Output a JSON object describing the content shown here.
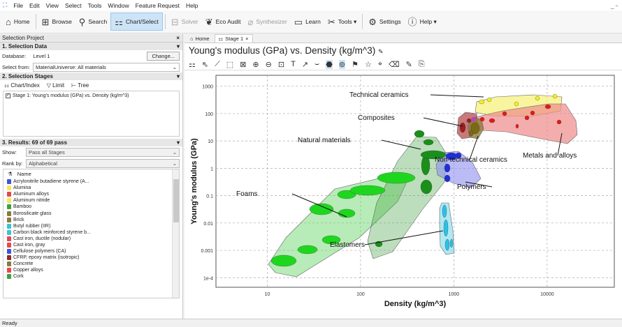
{
  "menu": [
    "File",
    "Edit",
    "View",
    "Select",
    "Tools",
    "Window",
    "Feature Request",
    "Help"
  ],
  "window_controls": "_ ▫",
  "toolbar": {
    "home": "Home",
    "browse": "Browse",
    "search": "Search",
    "chart_select": "Chart/Select",
    "solver": "Solver",
    "eco_audit": "Eco Audit",
    "synthesizer": "Synthesizer",
    "learn": "Learn",
    "tools": "Tools ▾",
    "settings": "Settings",
    "help": "Help ▾"
  },
  "left": {
    "panel_title": "Selection Project",
    "close": "×",
    "sec1": "1. Selection Data",
    "database_label": "Database:",
    "database_value": "Level 1",
    "change_btn": "Change...",
    "select_from_label": "Select from:",
    "select_from_value": "MaterialUniverse: All materials",
    "sec2": "2. Selection Stages",
    "chart_index": "Chart/Index",
    "limit": "Limit",
    "tree": "Tree",
    "stage1": "Stage 1: Young's modulus (GPa) vs. Density (kg/m^3)",
    "sec3": "3. Results: 69 of 69 pass",
    "show_label": "Show:",
    "show_value": "Pass all Stages",
    "rank_label": "Rank by:",
    "rank_value": "Alphabetical",
    "list_header": "Name",
    "items": [
      {
        "name": "Acrylonitrile butadiene styrene (A...",
        "color": "#3b55d9"
      },
      {
        "name": "Alumina",
        "color": "#f2e85a"
      },
      {
        "name": "Aluminum alloys",
        "color": "#e5484d"
      },
      {
        "name": "Aluminum nitride",
        "color": "#f2e85a"
      },
      {
        "name": "Bamboo",
        "color": "#3fa03f"
      },
      {
        "name": "Borosilicate glass",
        "color": "#8c7a3a"
      },
      {
        "name": "Brick",
        "color": "#8c7a3a"
      },
      {
        "name": "Butyl rubber (IIR)",
        "color": "#39c3d9"
      },
      {
        "name": "Carbon black reinforced styrene b...",
        "color": "#39c3d9"
      },
      {
        "name": "Cast iron, ductile (nodular)",
        "color": "#e5484d"
      },
      {
        "name": "Cast iron, gray",
        "color": "#e5484d"
      },
      {
        "name": "Cellulose polymers (CA)",
        "color": "#3b55d9"
      },
      {
        "name": "CFRP, epoxy matrix (isotropic)",
        "color": "#8b2c2c"
      },
      {
        "name": "Concrete",
        "color": "#8c7a3a"
      },
      {
        "name": "Copper alloys",
        "color": "#e5484d"
      },
      {
        "name": "Cork",
        "color": "#3fa03f"
      }
    ]
  },
  "right": {
    "tab_home": "Home",
    "tab_stage": "Stage 1",
    "tab_close": "×",
    "chart_title": "Young's modulus (GPa) vs. Density (kg/m^3)"
  },
  "chart_data": {
    "type": "scatter",
    "xlabel": "Density (kg/m^3)",
    "ylabel": "Young's modulus (GPa)",
    "x_scale": "log",
    "y_scale": "log",
    "x_ticks": [
      "10",
      "100",
      "1000",
      "10000"
    ],
    "y_ticks": [
      "1000",
      "100",
      "10",
      "1",
      "0.1",
      "0.01",
      "0.001",
      "1e-4"
    ],
    "grid": true,
    "families": [
      {
        "name": "Technical ceramics",
        "color": "#f5f06a"
      },
      {
        "name": "Composites",
        "color": "#a33"
      },
      {
        "name": "Natural materials",
        "color": "#3fa03f"
      },
      {
        "name": "Non-technical ceramics",
        "color": "#8c7a3a"
      },
      {
        "name": "Metals and alloys",
        "color": "#f08a8a"
      },
      {
        "name": "Foams",
        "color": "#5fd35f"
      },
      {
        "name": "Polymers",
        "color": "#8e8ef0"
      },
      {
        "name": "Elastomers",
        "color": "#6fd6e8"
      }
    ]
  },
  "status": "Ready"
}
